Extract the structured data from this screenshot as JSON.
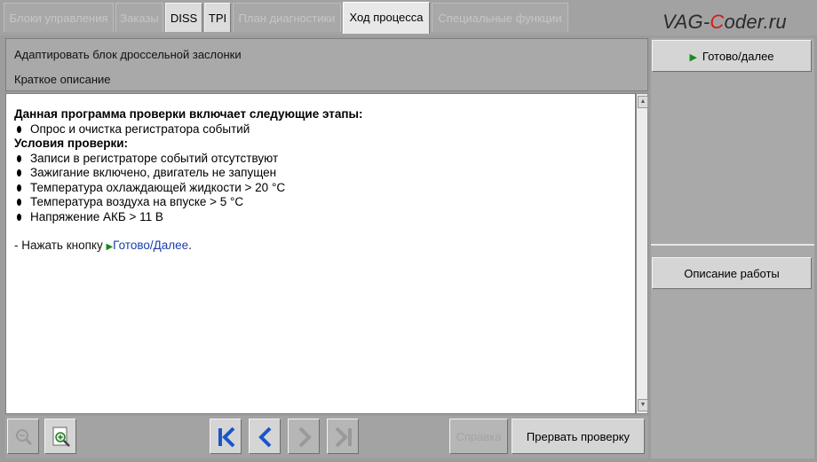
{
  "tabs": [
    {
      "label": "Блоки управления",
      "state": "disabled"
    },
    {
      "label": "Заказы",
      "state": "disabled"
    },
    {
      "label": "DISS",
      "state": "enabled"
    },
    {
      "label": "TPI",
      "state": "enabled"
    },
    {
      "label": "План диагностики",
      "state": "disabled"
    },
    {
      "label": "Ход процесса",
      "state": "active"
    },
    {
      "label": "Специальные функции",
      "state": "disabled"
    }
  ],
  "watermark": {
    "prefix": "VAG-",
    "accent": "C",
    "suffix": "oder.ru"
  },
  "header": {
    "title": "Адаптировать блок дроссельной заслонки",
    "subtitle": "Краткое описание"
  },
  "content": {
    "intro_heading": "Данная программа проверки включает следующие этапы:",
    "intro_items": [
      "Опрос и очистка регистратора событий"
    ],
    "conditions_heading": "Условия проверки:",
    "conditions": [
      "Записи в регистраторе событий отсутствуют",
      "Зажигание включено, двигатель не запущен",
      "Температура охлаждающей жидкости > 20 °C",
      "Температура воздуха на впуске > 5 °C",
      "Напряжение АКБ > 11 В"
    ],
    "press_prefix": "- Нажать кнопку",
    "press_link": "Готово/Далее",
    "press_suffix": "."
  },
  "bottombar": {
    "zoom_out_icon": "zoom-out-icon",
    "zoom_in_icon": "zoom-in-icon",
    "first_icon": "skip-first-icon",
    "prev_icon": "chevron-left-icon",
    "next_icon": "chevron-right-icon",
    "last_icon": "skip-last-icon",
    "help_label": "Справка",
    "abort_label": "Прервать проверку"
  },
  "side": {
    "ready_label": "Готово/далее",
    "description_label": "Описание работы"
  },
  "colors": {
    "accent_blue": "#1a55c8",
    "play_green": "#1a8a1a",
    "panel_gray": "#a9a9a9"
  }
}
